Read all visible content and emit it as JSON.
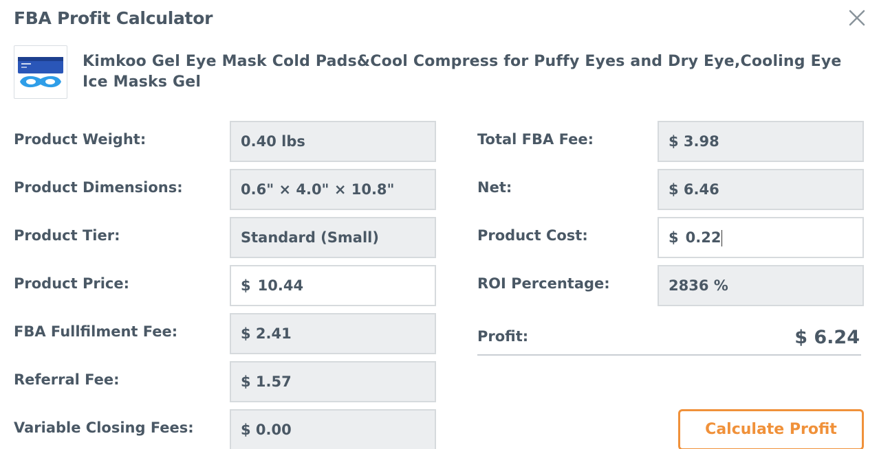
{
  "dialog": {
    "title": "FBA Profit Calculator",
    "close_icon": "close-icon"
  },
  "product": {
    "title": "Kimkoo Gel Eye Mask Cold Pads&Cool Compress for Puffy Eyes and Dry Eye,Cooling Eye Ice Masks Gel",
    "thumbnail_icon": "eye-mask-product-image"
  },
  "left_fields": {
    "weight": {
      "label": "Product Weight:",
      "value": "0.40 lbs"
    },
    "dimensions": {
      "label": "Product Dimensions:",
      "value": "0.6\" × 4.0\" × 10.8\""
    },
    "tier": {
      "label": "Product Tier:",
      "value": "Standard (Small)"
    },
    "price": {
      "label": "Product Price:",
      "currency": "$",
      "value": "10.44"
    },
    "fulfilment_fee": {
      "label": "FBA Fullfilment Fee:",
      "value": "$ 2.41"
    },
    "referral_fee": {
      "label": "Referral Fee:",
      "value": "$ 1.57"
    },
    "closing_fees": {
      "label": "Variable Closing Fees:",
      "value": "$ 0.00"
    }
  },
  "right_fields": {
    "total_fee": {
      "label": "Total FBA Fee:",
      "value": "$ 3.98"
    },
    "net": {
      "label": "Net:",
      "value": "$ 6.46"
    },
    "cost": {
      "label": "Product Cost:",
      "currency": "$",
      "value": "0.22"
    },
    "roi": {
      "label": "ROI Percentage:",
      "value": "2836 %"
    }
  },
  "profit": {
    "label": "Profit:",
    "value": "$ 6.24"
  },
  "actions": {
    "calculate_label": "Calculate Profit"
  },
  "colors": {
    "accent": "#f0913a",
    "text": "#4a5865",
    "readonly_bg": "#eceef0",
    "border": "#d6dadd"
  }
}
